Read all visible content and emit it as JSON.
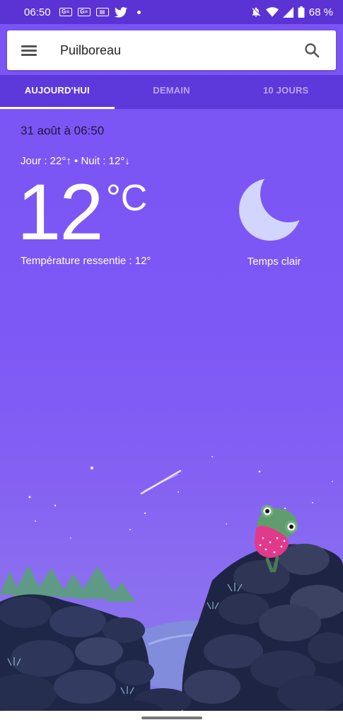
{
  "status_bar": {
    "time": "06:50",
    "left_icons": [
      "google-news-icon",
      "google-news-icon",
      "newspaper-icon",
      "twitter-icon",
      "dot-icon"
    ],
    "right_icons": [
      "notifications-off-icon",
      "wifi-icon",
      "signal-icon",
      "battery-icon"
    ],
    "battery": "68 %"
  },
  "search": {
    "location": "Puilboreau"
  },
  "tabs": [
    {
      "label": "AUJOURD'HUI",
      "active": true
    },
    {
      "label": "DEMAIN",
      "active": false
    },
    {
      "label": "10 JOURS",
      "active": false
    }
  ],
  "weather": {
    "date": "31 août à 06:50",
    "day_night": "Jour : 22°↑ • Nuit : 12°↓",
    "temperature": "12",
    "unit": "°C",
    "feels_like": "Température ressentie : 12°",
    "condition": "Temps clair",
    "condition_icon": "moon-icon"
  },
  "colors": {
    "status_bar": "#5b33d4",
    "tab_bar": "#5d38db",
    "background": "#7b55f0",
    "moon": "#cfd3ff"
  }
}
